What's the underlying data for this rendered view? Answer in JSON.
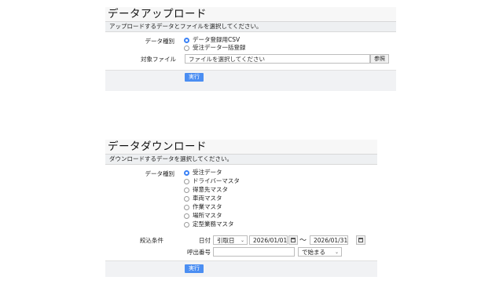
{
  "upload": {
    "title": "データアップロード",
    "description": "アップロードするデータとファイルを選択してください。",
    "type_label": "データ種別",
    "options": [
      "データ登録用CSV",
      "受注データ一括登録"
    ],
    "selected_index": 0,
    "file_label": "対象ファイル",
    "file_placeholder": "ファイルを選択してください",
    "browse_label": "参照",
    "execute_label": "実行"
  },
  "download": {
    "title": "データダウンロード",
    "description": "ダウンロードするデータを選択してください。",
    "type_label": "データ種別",
    "options": [
      "受注データ",
      "ドライバーマスタ",
      "得意先マスタ",
      "車両マスタ",
      "作業マスタ",
      "場所マスタ",
      "定型業務マスタ"
    ],
    "selected_index": 0,
    "filter_label": "絞込条件",
    "date_label": "日付",
    "date_type_value": "引取日",
    "date_from": "2026/01/01",
    "date_sep": "〜",
    "date_to": "2026/01/31",
    "call_no_label": "呼出番号",
    "call_no_value": "",
    "match_value": "で始まる",
    "execute_label": "実行"
  }
}
